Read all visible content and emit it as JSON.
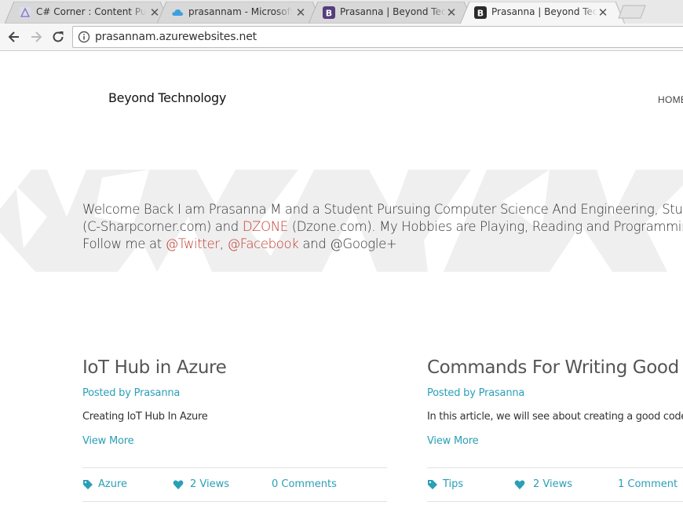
{
  "browser": {
    "tabs": [
      {
        "title": "C# Corner : Content Publ",
        "favicon": "csharp-corner-icon",
        "active": false
      },
      {
        "title": "prasannam - Microsoft A",
        "favicon": "azure-cloud-icon",
        "active": false
      },
      {
        "title": "Prasanna | Beyond Techn",
        "favicon": "bootstrap-b-icon",
        "active": false
      },
      {
        "title": "Prasanna | Beyond Techn",
        "favicon": "bootstrap-b-icon",
        "active": true
      }
    ],
    "close_glyph": "✕",
    "url": "prasannam.azurewebsites.net"
  },
  "site": {
    "brand": "Beyond Technology",
    "nav_home": "HOME"
  },
  "hero": {
    "line1": "Welcome Back I am Prasanna M and a Student Pursuing Computer Science And Engineering, Student",
    "line2_pre": "(C-Sharpcorner.com) and ",
    "line2_link": "DZONE",
    "line2_post": " (Dzone.com). My Hobbies are Playing, Reading and Programming a",
    "line3_pre": "Follow me at ",
    "twitter": "@Twitter",
    "sep": ", ",
    "facebook": "@Facebook",
    "line3_post": " and @Google+"
  },
  "posts": [
    {
      "title": "IoT Hub in Azure",
      "meta": "Posted by Prasanna",
      "excerpt": "Creating IoT Hub In Azure",
      "more": "View More",
      "tag": "Azure",
      "views": "2 Views",
      "comments": "0 Comments"
    },
    {
      "title": "Commands For Writing Good Co",
      "meta": "Posted by Prasanna",
      "excerpt": "In this article, we will see about creating a good code.",
      "more": "View More",
      "tag": "Tips",
      "views": "2 Views",
      "comments": "1 Comment"
    }
  ],
  "colors": {
    "accent": "#2a9fb6",
    "link_red": "#c0392b",
    "hero_bg": "#efefef",
    "bootstrap_purple": "#563d7c"
  }
}
